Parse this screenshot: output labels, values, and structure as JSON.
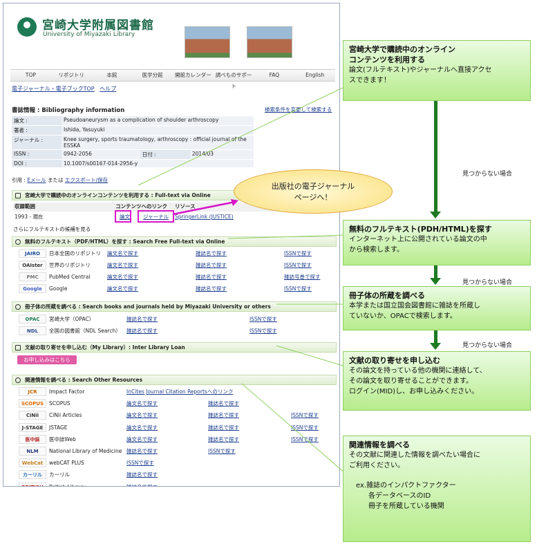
{
  "header": {
    "lib_name": "宮崎大学附属図書館",
    "lib_eng": "University of Miyazaki Library"
  },
  "nav": [
    "TOP",
    "リポジトリ",
    "本館",
    "医学分館",
    "開館カレンダー",
    "調べものサポート",
    "FAQ",
    "English"
  ],
  "subnav": {
    "ej": "電子ジャーナル・電子ブックTOP",
    "help": "ヘルプ"
  },
  "bib": {
    "title": "書誌情報 : Bibliography information",
    "change": "検索条件を変更して検索する",
    "rows": [
      [
        "論文 :",
        "Pseudoaneurysm as a complication of shoulder arthroscopy"
      ],
      [
        "著者 :",
        "Ishida, Yasuyuki"
      ],
      [
        "ジャーナル :",
        "Knee surgery, sports traumatology, arthroscopy : official journal of the ESSKA"
      ],
      [
        "ISSN :",
        "0942-2056"
      ],
      [
        "DOI :",
        "10.1007/s00167-014-2956-y"
      ]
    ],
    "date_label": "日付 :",
    "date": "2014/03"
  },
  "cite": {
    "label": "引用 :",
    "email": "Eメール",
    "or": "または",
    "export": "エクスポート/保存"
  },
  "fulltext": {
    "head": "宮崎大学で購読中のオンラインコンテンツを利用する : Full-text via Online",
    "col1": "収録範囲",
    "col2": "コンテンツへのリンク",
    "col3": "リソース",
    "range": "1993 - 現在",
    "link1": "論文",
    "link2": "ジャーナル",
    "resource": "SpringerLink (JUSTICE)"
  },
  "more": "さらにフルテキストの候補を見る",
  "free": {
    "head": "無料のフルテキスト（PDF/HTML）を探す : Search Free Full-text via Online",
    "rows": [
      {
        "logo": "JAIRO",
        "name": "日本全国のリポジトリ",
        "a": "論文名で探す",
        "b": "雑誌名で探す",
        "c": "ISSNで探す"
      },
      {
        "logo": "OAIster",
        "name": "世界のリポジトリ",
        "a": "論文名で探す",
        "b": "雑誌名で探す",
        "c": "ISSNで探す"
      },
      {
        "logo": "PMC",
        "name": "PubMed Central",
        "a": "論文名で探す",
        "b": "雑誌名で探す",
        "c": "雑誌号巻で探す"
      },
      {
        "logo": "Google",
        "name": "Google",
        "a": "論文名で探す",
        "b": "雑誌名で探す",
        "c": "ISSNで探す"
      }
    ]
  },
  "hold": {
    "head": "冊子体の所蔵を調べる : Search books and journals held by Miyazaki University or others",
    "rows": [
      {
        "logo": "OPAC",
        "name": "宮崎大学（OPAC）",
        "a": "雑誌名で探す",
        "c": "ISSNで探す"
      },
      {
        "logo": "NDL",
        "name": "全国の図書館（NDL Search）",
        "a": "雑誌名で探す",
        "c": "ISSNで探す"
      }
    ]
  },
  "ill": {
    "head": "文献の取り寄せを申し込む（My Library）: Inter Library Loan",
    "button": "お申し込みはこちら"
  },
  "other": {
    "head": "関連情報を調べる : Search Other Resources",
    "rows": [
      {
        "logo": "JCR",
        "name": "Impact Factor",
        "a": "InCites Journal Citation Reportsへのリンク",
        "b": "",
        "c": ""
      },
      {
        "logo": "SCOPUS",
        "name": "SCOPUS",
        "a": "論文名で探す",
        "b": "雑誌名で探す",
        "c": ""
      },
      {
        "logo": "CiNii",
        "name": "CiNii Articles",
        "a": "論文名で探す",
        "b": "雑誌名で探す",
        "c": "ISSNで探す"
      },
      {
        "logo": "J-STAGE",
        "name": "JSTAGE",
        "a": "論文名で探す",
        "b": "雑誌名で探す",
        "c": "ISSNで探す"
      },
      {
        "logo": "医中誌",
        "name": "医中誌Web",
        "a": "論文名で探す",
        "b": "雑誌名で探す",
        "c": "ISSNで探す"
      },
      {
        "logo": "NLM",
        "name": "National Library of Medicine",
        "a": "雑誌名で探す",
        "b": "ISSNで探す",
        "c": ""
      },
      {
        "logo": "WebCat",
        "name": "webCAT PLUS",
        "a": "ISSNで探す",
        "b": "",
        "c": ""
      },
      {
        "logo": "カーリル",
        "name": "カーリル",
        "a": "雑誌名で探す",
        "b": "",
        "c": ""
      },
      {
        "logo": "BRITISH",
        "name": "British Library",
        "a": "雑誌名で探す",
        "b": "",
        "c": ""
      }
    ]
  },
  "bubble": [
    "出版社の電子ジャーナル",
    "ページへ！"
  ],
  "callouts": [
    {
      "title": [
        "宮崎大学で購読中のオンライン",
        "コンテンツを利用する"
      ],
      "body": [
        "論文(フルテキスト)やジャーナルへ直接アクセ",
        "スできます！"
      ]
    },
    {
      "title": [
        "無料のフルテキスト(PDH/HTML)を探す"
      ],
      "body": [
        "インターネット上に公開されている論文の中",
        "から検索します。"
      ]
    },
    {
      "title": [
        "冊子体の所蔵を調べる"
      ],
      "body": [
        "本学または国立国会図書館に雑誌を所蔵し",
        "ていないか、OPACで検索します。"
      ]
    },
    {
      "title": [
        "文献の取り寄せを申し込む"
      ],
      "body": [
        "その論文を持っている他の機関に連絡して、",
        "その論文を取り寄せることができます。",
        "ログイン(MID)し、お申し込みください。"
      ]
    },
    {
      "title": [
        "関連情報を調べる"
      ],
      "body": [
        "その文献に関連した情報を調べたい場合に",
        "ご利用ください。"
      ],
      "extra": [
        "ex.雑誌のインパクトファクター",
        "各データベースのID",
        "冊子を所蔵している機関"
      ]
    }
  ],
  "not_found": "見つからない場合",
  "colors": {
    "callout_border": "#8fcf60",
    "arrow": "#1d7a22",
    "highlight": "#d814c8"
  }
}
